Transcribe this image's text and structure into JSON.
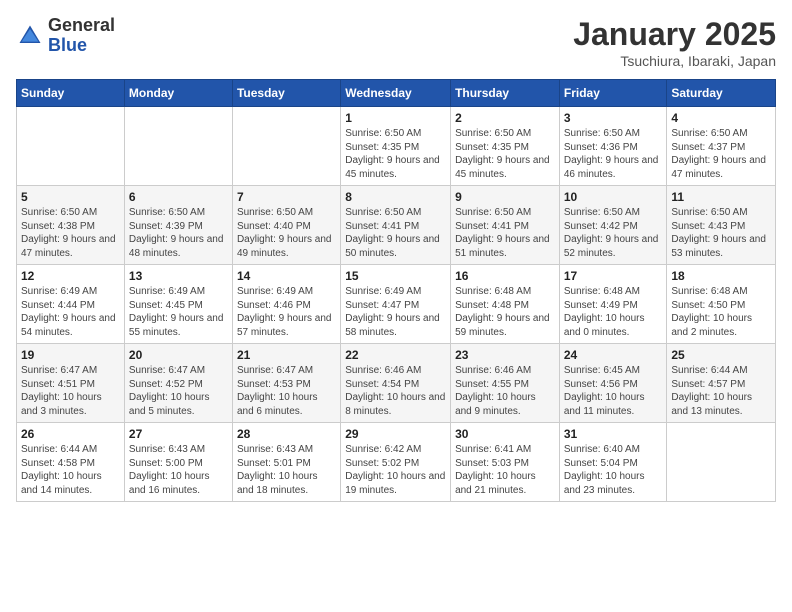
{
  "header": {
    "logo_general": "General",
    "logo_blue": "Blue",
    "title": "January 2025",
    "subtitle": "Tsuchiura, Ibaraki, Japan"
  },
  "weekdays": [
    "Sunday",
    "Monday",
    "Tuesday",
    "Wednesday",
    "Thursday",
    "Friday",
    "Saturday"
  ],
  "weeks": [
    [
      {
        "day": "",
        "info": ""
      },
      {
        "day": "",
        "info": ""
      },
      {
        "day": "",
        "info": ""
      },
      {
        "day": "1",
        "info": "Sunrise: 6:50 AM\nSunset: 4:35 PM\nDaylight: 9 hours and 45 minutes."
      },
      {
        "day": "2",
        "info": "Sunrise: 6:50 AM\nSunset: 4:35 PM\nDaylight: 9 hours and 45 minutes."
      },
      {
        "day": "3",
        "info": "Sunrise: 6:50 AM\nSunset: 4:36 PM\nDaylight: 9 hours and 46 minutes."
      },
      {
        "day": "4",
        "info": "Sunrise: 6:50 AM\nSunset: 4:37 PM\nDaylight: 9 hours and 47 minutes."
      }
    ],
    [
      {
        "day": "5",
        "info": "Sunrise: 6:50 AM\nSunset: 4:38 PM\nDaylight: 9 hours and 47 minutes."
      },
      {
        "day": "6",
        "info": "Sunrise: 6:50 AM\nSunset: 4:39 PM\nDaylight: 9 hours and 48 minutes."
      },
      {
        "day": "7",
        "info": "Sunrise: 6:50 AM\nSunset: 4:40 PM\nDaylight: 9 hours and 49 minutes."
      },
      {
        "day": "8",
        "info": "Sunrise: 6:50 AM\nSunset: 4:41 PM\nDaylight: 9 hours and 50 minutes."
      },
      {
        "day": "9",
        "info": "Sunrise: 6:50 AM\nSunset: 4:41 PM\nDaylight: 9 hours and 51 minutes."
      },
      {
        "day": "10",
        "info": "Sunrise: 6:50 AM\nSunset: 4:42 PM\nDaylight: 9 hours and 52 minutes."
      },
      {
        "day": "11",
        "info": "Sunrise: 6:50 AM\nSunset: 4:43 PM\nDaylight: 9 hours and 53 minutes."
      }
    ],
    [
      {
        "day": "12",
        "info": "Sunrise: 6:49 AM\nSunset: 4:44 PM\nDaylight: 9 hours and 54 minutes."
      },
      {
        "day": "13",
        "info": "Sunrise: 6:49 AM\nSunset: 4:45 PM\nDaylight: 9 hours and 55 minutes."
      },
      {
        "day": "14",
        "info": "Sunrise: 6:49 AM\nSunset: 4:46 PM\nDaylight: 9 hours and 57 minutes."
      },
      {
        "day": "15",
        "info": "Sunrise: 6:49 AM\nSunset: 4:47 PM\nDaylight: 9 hours and 58 minutes."
      },
      {
        "day": "16",
        "info": "Sunrise: 6:48 AM\nSunset: 4:48 PM\nDaylight: 9 hours and 59 minutes."
      },
      {
        "day": "17",
        "info": "Sunrise: 6:48 AM\nSunset: 4:49 PM\nDaylight: 10 hours and 0 minutes."
      },
      {
        "day": "18",
        "info": "Sunrise: 6:48 AM\nSunset: 4:50 PM\nDaylight: 10 hours and 2 minutes."
      }
    ],
    [
      {
        "day": "19",
        "info": "Sunrise: 6:47 AM\nSunset: 4:51 PM\nDaylight: 10 hours and 3 minutes."
      },
      {
        "day": "20",
        "info": "Sunrise: 6:47 AM\nSunset: 4:52 PM\nDaylight: 10 hours and 5 minutes."
      },
      {
        "day": "21",
        "info": "Sunrise: 6:47 AM\nSunset: 4:53 PM\nDaylight: 10 hours and 6 minutes."
      },
      {
        "day": "22",
        "info": "Sunrise: 6:46 AM\nSunset: 4:54 PM\nDaylight: 10 hours and 8 minutes."
      },
      {
        "day": "23",
        "info": "Sunrise: 6:46 AM\nSunset: 4:55 PM\nDaylight: 10 hours and 9 minutes."
      },
      {
        "day": "24",
        "info": "Sunrise: 6:45 AM\nSunset: 4:56 PM\nDaylight: 10 hours and 11 minutes."
      },
      {
        "day": "25",
        "info": "Sunrise: 6:44 AM\nSunset: 4:57 PM\nDaylight: 10 hours and 13 minutes."
      }
    ],
    [
      {
        "day": "26",
        "info": "Sunrise: 6:44 AM\nSunset: 4:58 PM\nDaylight: 10 hours and 14 minutes."
      },
      {
        "day": "27",
        "info": "Sunrise: 6:43 AM\nSunset: 5:00 PM\nDaylight: 10 hours and 16 minutes."
      },
      {
        "day": "28",
        "info": "Sunrise: 6:43 AM\nSunset: 5:01 PM\nDaylight: 10 hours and 18 minutes."
      },
      {
        "day": "29",
        "info": "Sunrise: 6:42 AM\nSunset: 5:02 PM\nDaylight: 10 hours and 19 minutes."
      },
      {
        "day": "30",
        "info": "Sunrise: 6:41 AM\nSunset: 5:03 PM\nDaylight: 10 hours and 21 minutes."
      },
      {
        "day": "31",
        "info": "Sunrise: 6:40 AM\nSunset: 5:04 PM\nDaylight: 10 hours and 23 minutes."
      },
      {
        "day": "",
        "info": ""
      }
    ]
  ]
}
